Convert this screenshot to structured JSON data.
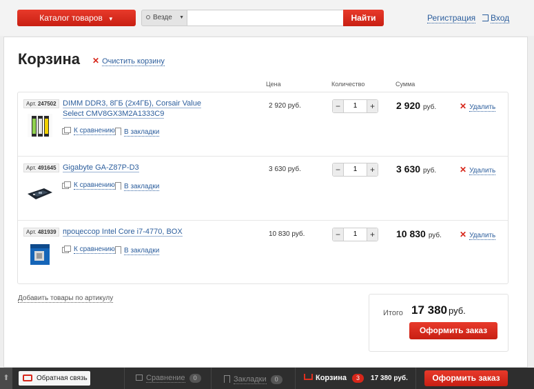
{
  "header": {
    "catalog_label": "Каталог товаров",
    "scope_label": "Везде",
    "search_value": "",
    "search_button": "Найти",
    "register_link": "Регистрация",
    "login_link": "Вход"
  },
  "cart": {
    "title": "Корзина",
    "clear_label": "Очистить корзину",
    "columns": {
      "price": "Цена",
      "quantity": "Количество",
      "sum": "Сумма"
    },
    "compare_label": "К сравнению",
    "bookmark_label": "В закладки",
    "remove_label": "Удалить",
    "art_prefix": "Арт.",
    "items": [
      {
        "art": "247502",
        "name": "DIMM DDR3, 8ГБ (2x4ГБ), Corsair Value Select CMV8GX3M2A1333C9",
        "price": "2 920 руб.",
        "qty": "1",
        "sum": "2 920",
        "sum_currency": "руб."
      },
      {
        "art": "491645",
        "name": "Gigabyte GA-Z87P-D3",
        "price": "3 630 руб.",
        "qty": "1",
        "sum": "3 630",
        "sum_currency": "руб."
      },
      {
        "art": "481939",
        "name": "процессор Intel Core i7-4770, BOX",
        "price": "10 830 руб.",
        "qty": "1",
        "sum": "10 830",
        "sum_currency": "руб."
      }
    ],
    "add_by_article": "Добавить товары по артикулу",
    "total_label": "Итого",
    "total_value": "17 380",
    "total_currency": "руб.",
    "order_button": "Оформить заказ"
  },
  "bottom_bar": {
    "feedback_label": "Обратная связь",
    "compare_label": "Сравнение",
    "compare_count": "0",
    "bookmarks_label": "Закладки",
    "bookmarks_count": "0",
    "cart_label": "Корзина",
    "cart_count": "3",
    "cart_amount": "17 380 руб.",
    "order_button": "Оформить заказ"
  },
  "colors": {
    "accent": "#d7261a",
    "link": "#2b5d9c",
    "bar": "#2e2e2e"
  }
}
